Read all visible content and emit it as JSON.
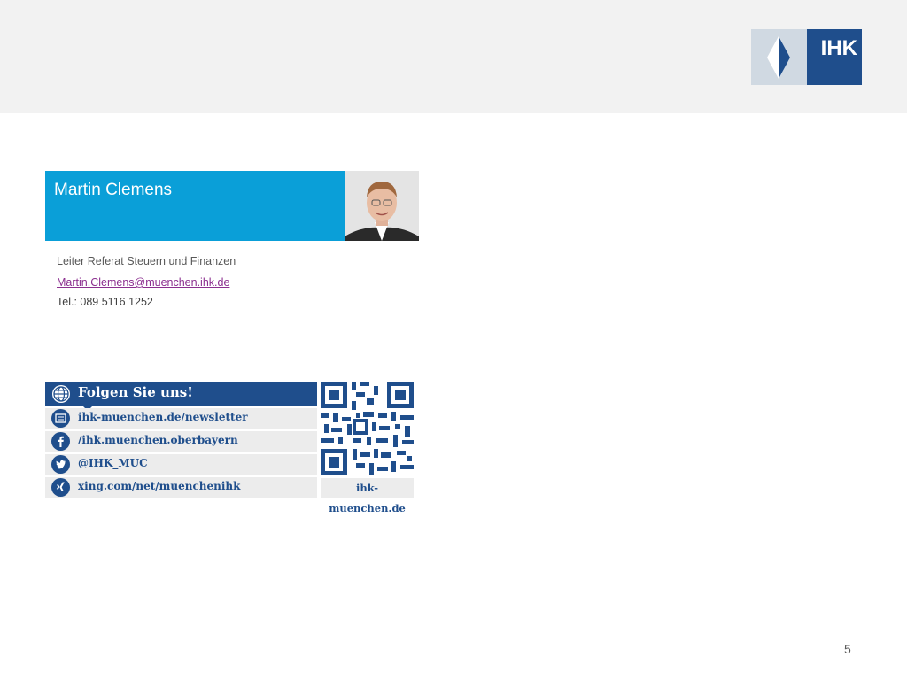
{
  "header": {
    "logo_text": "IHK"
  },
  "contact": {
    "name": "Martin Clemens",
    "role": "Leiter Referat Steuern und Finanzen",
    "email": "Martin.Clemens@muenchen.ihk.de",
    "phone": "Tel.: 089 5116 1252"
  },
  "social": {
    "title": "Folgen Sie uns!",
    "items": [
      {
        "icon": "newsletter-icon",
        "text": "ihk-muenchen.de/newsletter"
      },
      {
        "icon": "facebook-icon",
        "text": "/ihk.muenchen.oberbayern"
      },
      {
        "icon": "twitter-icon",
        "text": "@IHK_MUC"
      },
      {
        "icon": "xing-icon",
        "text": "xing.com/net/muenchenihk"
      }
    ],
    "qr_caption": "ihk-muenchen.de"
  },
  "footer": {
    "page_number": "5"
  },
  "colors": {
    "ihk_blue": "#1f4e8c",
    "name_bar": "#0a9fd8",
    "email": "#8b2f8f"
  }
}
